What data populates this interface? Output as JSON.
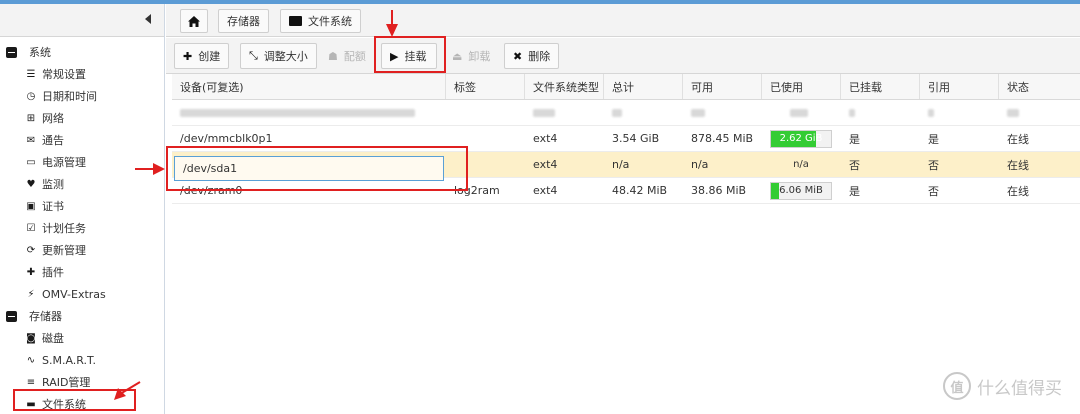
{
  "sidebar": {
    "groups": [
      {
        "label": "系统",
        "items": [
          {
            "label": "常规设置",
            "icon": "sliders-icon"
          },
          {
            "label": "日期和时间",
            "icon": "clock-icon"
          },
          {
            "label": "网络",
            "icon": "network-icon"
          },
          {
            "label": "通告",
            "icon": "envelope-icon"
          },
          {
            "label": "电源管理",
            "icon": "battery-icon"
          },
          {
            "label": "监测",
            "icon": "heartbeat-icon"
          },
          {
            "label": "证书",
            "icon": "certificate-icon"
          },
          {
            "label": "计划任务",
            "icon": "tasks-icon"
          },
          {
            "label": "更新管理",
            "icon": "refresh-icon"
          },
          {
            "label": "插件",
            "icon": "puzzle-icon"
          },
          {
            "label": "OMV-Extras",
            "icon": "plug-icon"
          }
        ]
      },
      {
        "label": "存储器",
        "items": [
          {
            "label": "磁盘",
            "icon": "disk-icon"
          },
          {
            "label": "S.M.A.R.T.",
            "icon": "pulse-icon"
          },
          {
            "label": "RAID管理",
            "icon": "database-icon"
          },
          {
            "label": "文件系统",
            "icon": "folder-icon"
          }
        ]
      }
    ]
  },
  "breadcrumb": {
    "storage": "存储器",
    "filesystems": "文件系统"
  },
  "toolbar": {
    "create": "创建",
    "resize": "调整大小",
    "quota": "配额",
    "mount": "挂载",
    "unmount": "卸载",
    "delete": "删除"
  },
  "table": {
    "headers": [
      "设备(可复选)",
      "标签",
      "文件系统类型",
      "总计",
      "可用",
      "已使用",
      "已挂载",
      "引用",
      "状态"
    ],
    "rows": [
      {
        "device": "/dev/mmcblk0p1",
        "label": "",
        "type": "ext4",
        "total": "3.54 GiB",
        "available": "878.45 MiB",
        "used": "2.62 GiB",
        "used_fraction": 0.75,
        "mounted": "是",
        "referenced": "是",
        "status": "在线"
      },
      {
        "device": "/dev/sda1",
        "label": "",
        "type": "ext4",
        "total": "n/a",
        "available": "n/a",
        "used": "n/a",
        "used_fraction": 0,
        "mounted": "否",
        "referenced": "否",
        "status": "在线"
      },
      {
        "device": "/dev/zram0",
        "label": "log2ram",
        "type": "ext4",
        "total": "48.42 MiB",
        "available": "38.86 MiB",
        "used": "6.06 MiB",
        "used_fraction": 0.13,
        "mounted": "是",
        "referenced": "否",
        "status": "在线"
      }
    ]
  },
  "watermark": "什么值得买",
  "colors": {
    "accent": "#5b9bd5",
    "selected_row": "#fdf0c9",
    "usage_fill": "#33cc33",
    "annotation_red": "#e02020"
  }
}
